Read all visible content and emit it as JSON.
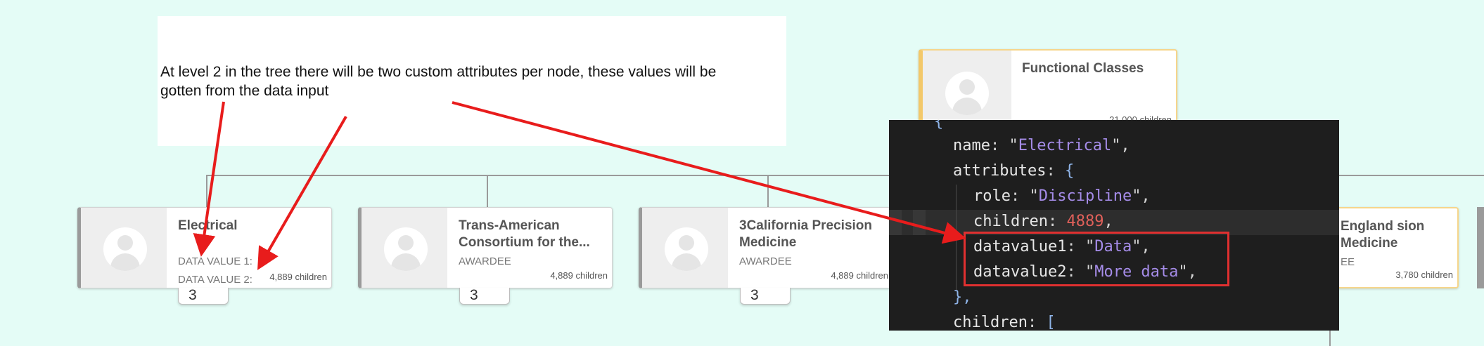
{
  "note": {
    "text": "At level 2 in the tree there will be two custom attributes per node, these values will be gotten from the data input"
  },
  "top_node": {
    "title": "Functional Classes",
    "children": "21,000 children"
  },
  "nodes": [
    {
      "title": "Electrical",
      "sub1": "DATA VALUE 1:",
      "sub2": "DATA VALUE 2:",
      "children": "4,889 children",
      "tab": "3"
    },
    {
      "title": "Trans-American Consortium for the...",
      "sub1": "AWARDEE",
      "children": "4,889 children",
      "tab": "3"
    },
    {
      "title": "3California Precision Medicine",
      "sub1": "AWARDEE",
      "children": "4,889 children",
      "tab": "3"
    },
    {
      "title": "England sion Medicine",
      "sub1": "EE",
      "children": "3,780 children"
    }
  ],
  "code": {
    "l0": "{",
    "l1_key": "name",
    "l1_val": "Electrical",
    "l2_key": "attributes",
    "l2_open": "{",
    "l3_key": "role",
    "l3_val": "Discipline",
    "l4_key": "children",
    "l4_val": "4889",
    "l5_key": "datavalue1",
    "l5_val": "Data",
    "l6_key": "datavalue2",
    "l6_val": "More data",
    "l7": "},",
    "l8_key": "children",
    "l8_open": "["
  },
  "colors": {
    "background": "#e4fcf6",
    "annotation_red": "#e81c1c",
    "code_background": "#1e1e1e",
    "code_string": "#a58ce8",
    "code_number": "#e0605a",
    "highlight_border": "#f3c86a"
  }
}
